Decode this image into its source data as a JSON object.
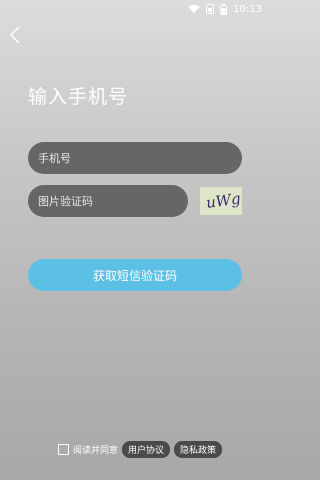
{
  "status_bar": {
    "time": "10:13"
  },
  "title": "输入手机号",
  "phone_field": {
    "placeholder": "手机号"
  },
  "captcha_field": {
    "placeholder": "图片验证码"
  },
  "captcha_image_text": "uWg",
  "sms_button_label": "获取短信验证码",
  "agreement": {
    "text": "阅读并同意",
    "user_agreement": "用户协议",
    "privacy_policy": "隐私政策"
  }
}
